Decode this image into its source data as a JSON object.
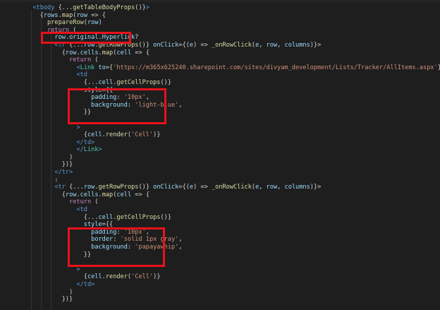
{
  "editor": {
    "lines": [
      [
        [
          "p",
          "  "
        ],
        [
          "tag",
          "<tbody"
        ],
        [
          "p",
          " {"
        ],
        [
          "p",
          "..."
        ],
        [
          "fn",
          "getTableBodyProps"
        ],
        [
          "p",
          "()}"
        ],
        [
          "tag",
          ">"
        ]
      ],
      [
        [
          "p",
          "    {"
        ],
        [
          "var",
          "rows"
        ],
        [
          "p",
          "."
        ],
        [
          "fn",
          "map"
        ],
        [
          "p",
          "("
        ],
        [
          "var",
          "row"
        ],
        [
          "p",
          " => {"
        ]
      ],
      [
        [
          "p",
          "      "
        ],
        [
          "fn",
          "prepareRow"
        ],
        [
          "p",
          "("
        ],
        [
          "var",
          "row"
        ],
        [
          "p",
          ")"
        ]
      ],
      [
        [
          "p",
          "      "
        ],
        [
          "kw",
          "return"
        ],
        [
          "p",
          " ("
        ]
      ],
      [
        [
          "p",
          "        "
        ],
        [
          "var",
          "row"
        ],
        [
          "p",
          "."
        ],
        [
          "var",
          "original"
        ],
        [
          "p",
          "."
        ],
        [
          "var",
          "Hyperlink"
        ],
        [
          "p",
          "?"
        ]
      ],
      [
        [
          "p",
          "        "
        ],
        [
          "tag",
          "<tr"
        ],
        [
          "p",
          " {"
        ],
        [
          "p",
          "..."
        ],
        [
          "var",
          "row"
        ],
        [
          "p",
          "."
        ],
        [
          "fn",
          "getRowProps"
        ],
        [
          "p",
          "()} "
        ],
        [
          "attr",
          "onClick"
        ],
        [
          "p",
          "={("
        ],
        [
          "var",
          "e"
        ],
        [
          "p",
          ") => "
        ],
        [
          "fn",
          "_onRowClick"
        ],
        [
          "p",
          "("
        ],
        [
          "var",
          "e"
        ],
        [
          "p",
          ", "
        ],
        [
          "var",
          "row"
        ],
        [
          "p",
          ", "
        ],
        [
          "var",
          "columns"
        ],
        [
          "p",
          ")}>"
        ]
      ],
      [
        [
          "p",
          "          {"
        ],
        [
          "var",
          "row"
        ],
        [
          "p",
          "."
        ],
        [
          "var",
          "cells"
        ],
        [
          "p",
          "."
        ],
        [
          "fn",
          "map"
        ],
        [
          "p",
          "("
        ],
        [
          "var",
          "cell"
        ],
        [
          "p",
          " => {"
        ]
      ],
      [
        [
          "p",
          "            "
        ],
        [
          "kw",
          "return"
        ],
        [
          "p",
          " ("
        ]
      ],
      [
        [
          "p",
          "              "
        ],
        [
          "tag",
          "<"
        ],
        [
          "cmp",
          "Link"
        ],
        [
          "p",
          " "
        ],
        [
          "attr",
          "to"
        ],
        [
          "p",
          "={"
        ],
        [
          "str",
          "'https://m365x625240.sharepoint.com/sites/divyam_development/Lists/Tracker/AllItems.aspx'"
        ],
        [
          "p",
          "}"
        ],
        [
          "tag",
          ">"
        ]
      ],
      [
        [
          "p",
          "              "
        ],
        [
          "tag",
          "<td"
        ]
      ],
      [
        [
          "p",
          "                {"
        ],
        [
          "p",
          "..."
        ],
        [
          "var",
          "cell"
        ],
        [
          "p",
          "."
        ],
        [
          "fn",
          "getCellProps"
        ],
        [
          "p",
          "()}"
        ]
      ],
      [
        [
          "p",
          "                "
        ],
        [
          "attr",
          "style"
        ],
        [
          "p",
          "={{"
        ]
      ],
      [
        [
          "p",
          "                  "
        ],
        [
          "prop",
          "padding"
        ],
        [
          "p",
          ": "
        ],
        [
          "str",
          "'10px'"
        ],
        [
          "p",
          ","
        ]
      ],
      [
        [
          "p",
          "                  "
        ],
        [
          "prop",
          "background"
        ],
        [
          "p",
          ": "
        ],
        [
          "str",
          "'light-blue'"
        ],
        [
          "p",
          ","
        ]
      ],
      [
        [
          "p",
          "                }}"
        ]
      ],
      [
        [
          "p",
          ""
        ]
      ],
      [
        [
          "p",
          "              "
        ],
        [
          "tag",
          ">"
        ]
      ],
      [
        [
          "p",
          "                {"
        ],
        [
          "var",
          "cell"
        ],
        [
          "p",
          "."
        ],
        [
          "fn",
          "render"
        ],
        [
          "p",
          "("
        ],
        [
          "str",
          "'Cell'"
        ],
        [
          "p",
          ")}"
        ]
      ],
      [
        [
          "p",
          "              "
        ],
        [
          "tag",
          "</td>"
        ]
      ],
      [
        [
          "p",
          "              "
        ],
        [
          "tag",
          "</"
        ],
        [
          "cmp",
          "Link"
        ],
        [
          "tag",
          ">"
        ]
      ],
      [
        [
          "p",
          "            )"
        ]
      ],
      [
        [
          "p",
          "          })}"
        ]
      ],
      [
        [
          "p",
          "        "
        ],
        [
          "tag",
          "</tr>"
        ]
      ],
      [
        [
          "p",
          "        :"
        ]
      ],
      [
        [
          "p",
          "        "
        ],
        [
          "tag",
          "<tr"
        ],
        [
          "p",
          " {"
        ],
        [
          "p",
          "..."
        ],
        [
          "var",
          "row"
        ],
        [
          "p",
          "."
        ],
        [
          "fn",
          "getRowProps"
        ],
        [
          "p",
          "()} "
        ],
        [
          "attr",
          "onClick"
        ],
        [
          "p",
          "={("
        ],
        [
          "var",
          "e"
        ],
        [
          "p",
          ") => "
        ],
        [
          "fn",
          "_onRowClick"
        ],
        [
          "p",
          "("
        ],
        [
          "var",
          "e"
        ],
        [
          "p",
          ", "
        ],
        [
          "var",
          "row"
        ],
        [
          "p",
          ", "
        ],
        [
          "var",
          "columns"
        ],
        [
          "p",
          ")}>"
        ]
      ],
      [
        [
          "p",
          "          {"
        ],
        [
          "var",
          "row"
        ],
        [
          "p",
          "."
        ],
        [
          "var",
          "cells"
        ],
        [
          "p",
          "."
        ],
        [
          "fn",
          "map"
        ],
        [
          "p",
          "("
        ],
        [
          "var",
          "cell"
        ],
        [
          "p",
          " => {"
        ]
      ],
      [
        [
          "p",
          "            "
        ],
        [
          "kw",
          "return"
        ],
        [
          "p",
          " ("
        ]
      ],
      [
        [
          "p",
          "              "
        ],
        [
          "tag",
          "<td"
        ]
      ],
      [
        [
          "p",
          "                {"
        ],
        [
          "p",
          "..."
        ],
        [
          "var",
          "cell"
        ],
        [
          "p",
          "."
        ],
        [
          "fn",
          "getCellProps"
        ],
        [
          "p",
          "()}"
        ]
      ],
      [
        [
          "p",
          "                "
        ],
        [
          "attr",
          "style"
        ],
        [
          "p",
          "={{"
        ]
      ],
      [
        [
          "p",
          "                  "
        ],
        [
          "prop",
          "padding"
        ],
        [
          "p",
          ": "
        ],
        [
          "str",
          "'10px'"
        ],
        [
          "p",
          ","
        ]
      ],
      [
        [
          "p",
          "                  "
        ],
        [
          "prop",
          "border"
        ],
        [
          "p",
          ": "
        ],
        [
          "str",
          "'solid 1px gray'"
        ],
        [
          "p",
          ","
        ]
      ],
      [
        [
          "p",
          "                  "
        ],
        [
          "prop",
          "background"
        ],
        [
          "p",
          ": "
        ],
        [
          "str",
          "'papayawhip'"
        ],
        [
          "p",
          ","
        ]
      ],
      [
        [
          "p",
          "                }}"
        ]
      ],
      [
        [
          "p",
          ""
        ]
      ],
      [
        [
          "p",
          "              "
        ],
        [
          "tag",
          ">"
        ]
      ],
      [
        [
          "p",
          "                {"
        ],
        [
          "var",
          "cell"
        ],
        [
          "p",
          "."
        ],
        [
          "fn",
          "render"
        ],
        [
          "p",
          "("
        ],
        [
          "str",
          "'Cell'"
        ],
        [
          "p",
          ")}"
        ]
      ],
      [
        [
          "p",
          "              "
        ],
        [
          "tag",
          "</td>"
        ]
      ],
      [
        [
          "p",
          "            )"
        ]
      ],
      [
        [
          "p",
          "          })}"
        ]
      ]
    ],
    "highlight_color": "#e8121b",
    "background_color": "#1e1e1e"
  }
}
